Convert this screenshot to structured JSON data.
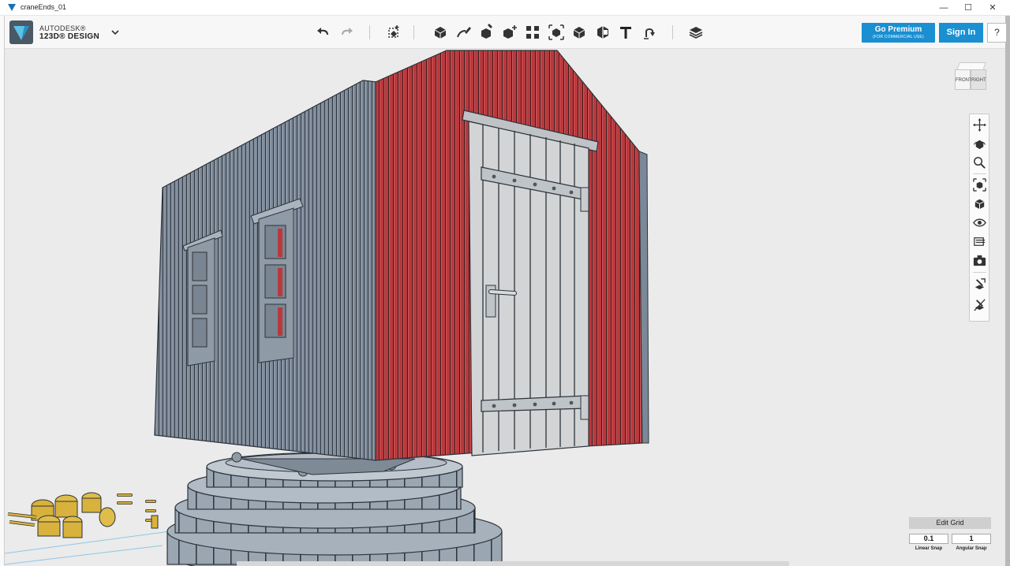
{
  "window": {
    "title": "craneEnds_01",
    "minimize": "—",
    "maximize": "☐",
    "close": "✕"
  },
  "brand": {
    "company": "AUTODESK®",
    "product": "123D® DESIGN"
  },
  "toolbar": {
    "tools": [
      "undo-icon",
      "redo-icon",
      "transform-icon",
      "primitives-icon",
      "sketch-icon",
      "construct-icon",
      "modify-icon",
      "pattern-icon",
      "grouping-icon",
      "combine-icon",
      "measure-icon",
      "text-icon",
      "snap-icon",
      "material-icon"
    ]
  },
  "account": {
    "premium_label": "Go Premium",
    "premium_sub": "(FOR COMMERCIAL USE)",
    "sign_in": "Sign In",
    "help": "?"
  },
  "viewcube": {
    "front": "FRONT",
    "right": "RIGHT"
  },
  "nav": {
    "tools": [
      "pan-icon",
      "orbit-icon",
      "zoom-icon",
      "fit-icon",
      "views-icon",
      "visibility-icon",
      "material-display-icon",
      "camera-icon",
      "snap-tool-icon",
      "snap-off-icon"
    ]
  },
  "grid": {
    "edit_grid": "Edit Grid",
    "linear_value": "0.1",
    "angular_value": "1",
    "linear_label": "Linear Snap",
    "angular_label": "Angular Snap"
  },
  "colors": {
    "accent": "#1a8fd1",
    "wall_grey": "#6e7d8d",
    "wall_red": "#b6393d",
    "door": "#cfcfcf",
    "gold": "#d8b23c"
  }
}
